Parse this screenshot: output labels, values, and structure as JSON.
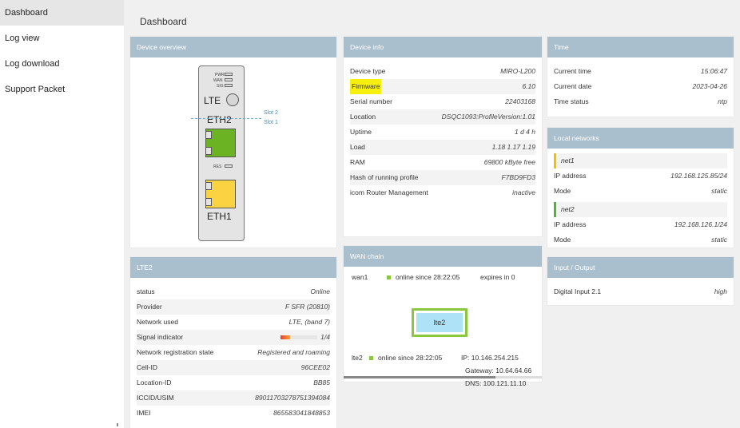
{
  "sidebar": {
    "items": [
      {
        "label": "Dashboard",
        "active": true
      },
      {
        "label": "Log view"
      },
      {
        "label": "Log download"
      },
      {
        "label": "Support Packet"
      }
    ]
  },
  "page": {
    "title": "Dashboard"
  },
  "device_overview": {
    "header": "Device overview",
    "leds": [
      "PWR",
      "WAN",
      "SIG"
    ],
    "lte": "LTE",
    "eth2": "ETH2",
    "res": "RES",
    "eth1": "ETH1",
    "slot2": "Slot 2",
    "slot1": "Slot 1",
    "colors": {
      "eth2_port": "#6bb323",
      "eth1_port": "#fbd342"
    }
  },
  "device_info": {
    "header": "Device info",
    "rows": [
      {
        "key": "Device type",
        "value": "MIRO-L200"
      },
      {
        "key": "Firmware",
        "value": "6.10"
      },
      {
        "key": "Serial number",
        "value": "22403168"
      },
      {
        "key": "Location",
        "value": "DSQC1093:ProfileVersion:1.01"
      },
      {
        "key": "Uptime",
        "value": "1 d 4 h"
      },
      {
        "key": "Load",
        "value": "1.18 1.17 1.19"
      },
      {
        "key": "RAM",
        "value": "69800 kByte free"
      },
      {
        "key": "Hash of running profile",
        "value": "F7BD9FD3"
      },
      {
        "key": "icom Router Management",
        "value": "inactive"
      }
    ]
  },
  "time": {
    "header": "Time",
    "rows": [
      {
        "key": "Current time",
        "value": "15:06:47"
      },
      {
        "key": "Current date",
        "value": "2023-04-26"
      },
      {
        "key": "Time status",
        "value": "ntp"
      }
    ]
  },
  "local_networks": {
    "header": "Local networks",
    "nets": [
      {
        "name": "net1",
        "ip_label": "IP address",
        "ip": "192.168.125.85/24",
        "mode_label": "Mode",
        "mode": "static"
      },
      {
        "name": "net2",
        "ip_label": "IP address",
        "ip": "192.168.126.1/24",
        "mode_label": "Mode",
        "mode": "static"
      }
    ]
  },
  "lte2": {
    "header": "LTE2",
    "rows": [
      {
        "key": "status",
        "value": "Online"
      },
      {
        "key": "Provider",
        "value": "F SFR (20810)"
      },
      {
        "key": "Network used",
        "value": "LTE, (band 7)"
      },
      {
        "key": "Signal indicator",
        "value": "1/4"
      },
      {
        "key": "Network registration state",
        "value": "Registered and roaming"
      },
      {
        "key": "Cell-ID",
        "value": "96CEE02"
      },
      {
        "key": "Location-ID",
        "value": "BB85"
      },
      {
        "key": "ICCID/USIM",
        "value": "89011703278751394084"
      },
      {
        "key": "IMEI",
        "value": "865583041848853"
      }
    ],
    "signal_fraction": 0.25
  },
  "wan_chain": {
    "header": "WAN chain",
    "wan1": {
      "name": "wan1",
      "status": "online since 28:22:05",
      "expires": "expires in 0"
    },
    "box_label": "lte2",
    "lte2": {
      "name": "lte2",
      "status": "online since 28:22:05",
      "ip": "IP: 10.146.254.215",
      "gateway": "Gateway: 10.64.64.66",
      "dns": "DNS: 100.121.11.10"
    }
  },
  "io": {
    "header": "Input / Output",
    "rows": [
      {
        "key": "Digital Input 2.1",
        "value": "high"
      }
    ]
  }
}
